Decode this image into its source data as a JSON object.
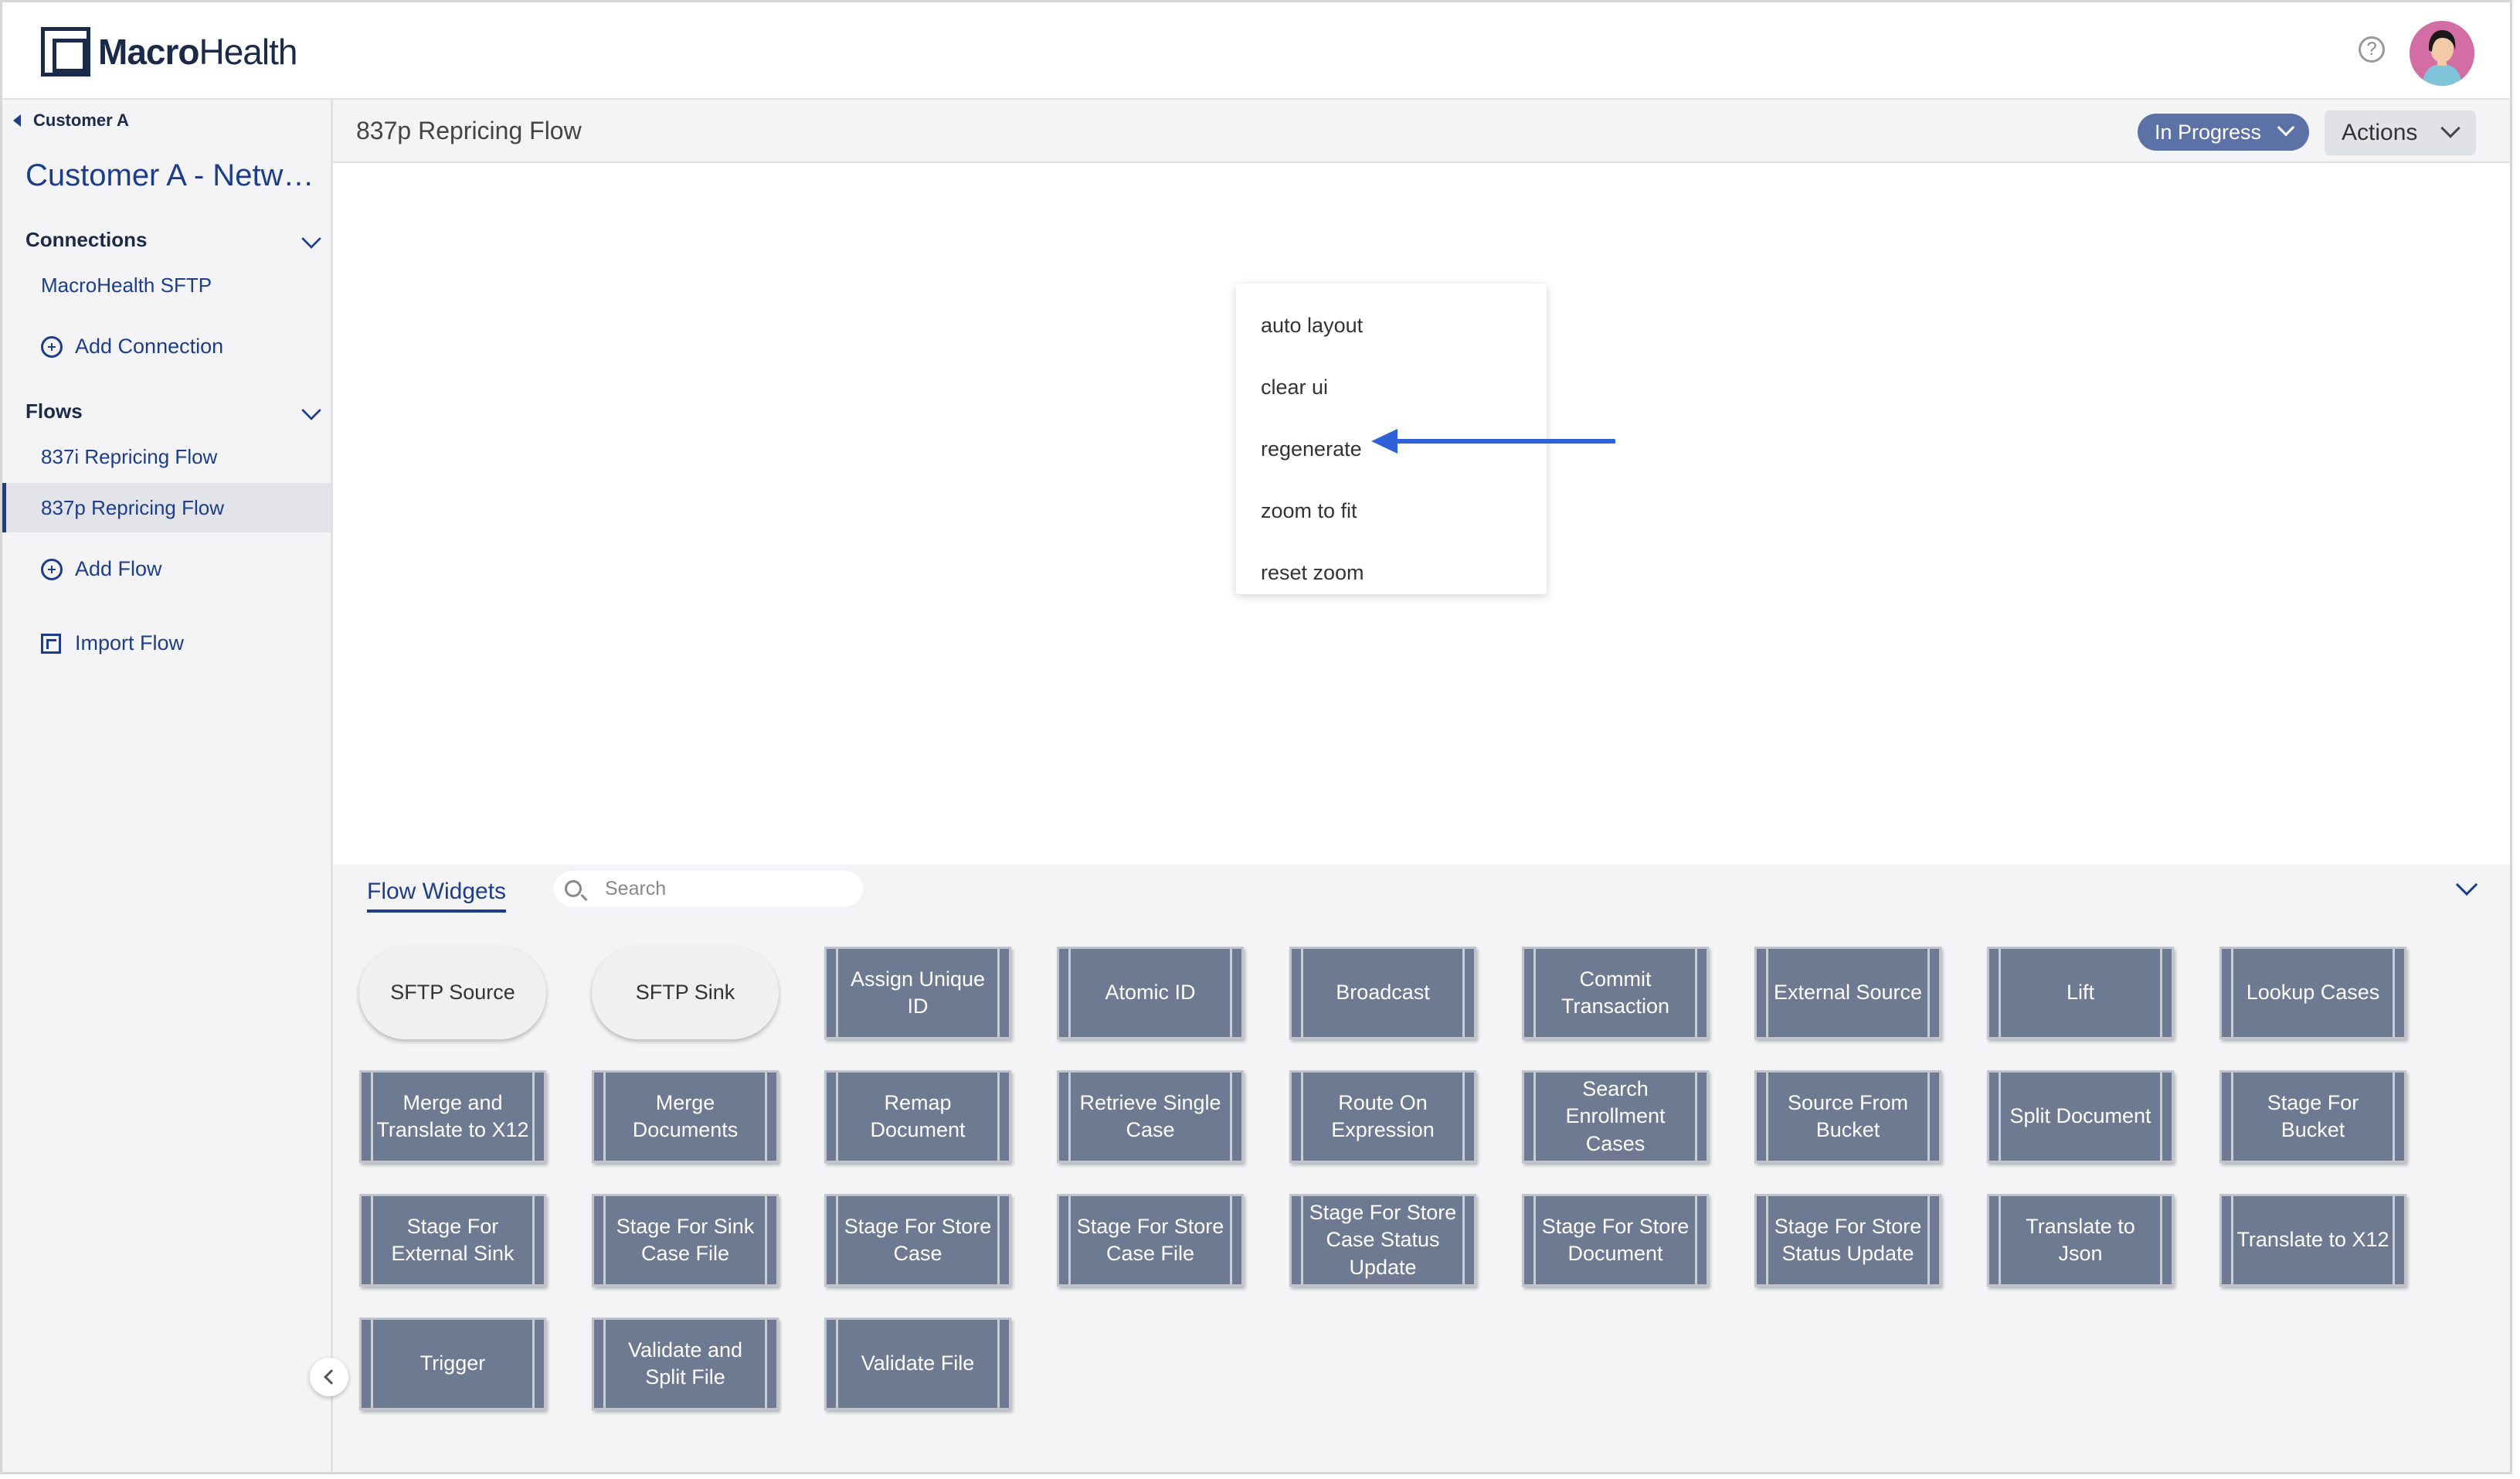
{
  "brand": {
    "bold": "Macro",
    "light": "Health"
  },
  "sidebar": {
    "back_label": "Customer A",
    "project_title": "Customer A - Network",
    "connections_label": "Connections",
    "connections": [
      "MacroHealth SFTP"
    ],
    "add_connection": "Add Connection",
    "flows_label": "Flows",
    "flows": [
      "837i Repricing Flow",
      "837p Repricing Flow"
    ],
    "active_flow_index": 1,
    "add_flow": "Add Flow",
    "import_flow": "Import Flow"
  },
  "main": {
    "flow_title": "837p Repricing Flow",
    "status": "In Progress",
    "actions": "Actions"
  },
  "context_menu": {
    "items": [
      "auto layout",
      "clear ui",
      "regenerate",
      "zoom to fit",
      "reset zoom"
    ],
    "highlighted": "regenerate",
    "arrow_color": "#2f62d8"
  },
  "widgets": {
    "tab_label": "Flow Widgets",
    "search_placeholder": "Search",
    "rows": [
      [
        "SFTP Source",
        "SFTP Sink",
        "Assign Unique ID",
        "Atomic ID",
        "Broadcast",
        "Commit Transaction",
        "External Source",
        "Lift",
        "Lookup Cases"
      ],
      [
        "Merge and Translate to X12",
        "Merge Documents",
        "Remap Document",
        "Retrieve Single Case",
        "Route On Expression",
        "Search Enrollment Cases",
        "Source From Bucket",
        "Split Document",
        "Stage For Bucket"
      ],
      [
        "Stage For External Sink",
        "Stage For Sink Case File",
        "Stage For Store Case",
        "Stage For Store Case File",
        "Stage For Store Case Status Update",
        "Stage For Store Document",
        "Stage For Store Status Update",
        "Translate to Json",
        "Translate to X12"
      ],
      [
        "Trigger",
        "Validate and Split File",
        "Validate File"
      ]
    ],
    "rounded_items": [
      "SFTP Source",
      "SFTP Sink"
    ]
  },
  "colors": {
    "brand_navy": "#1c2a4a",
    "link_blue": "#1c3e8a",
    "status_pill": "#5c72a6",
    "widget_fill": "#6d7a91"
  }
}
